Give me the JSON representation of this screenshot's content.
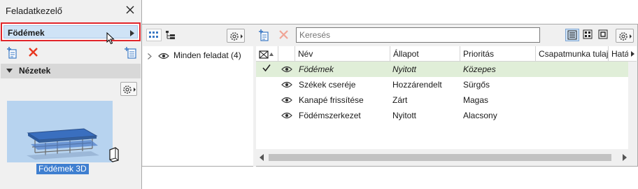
{
  "left_panel": {
    "title": "Feladatkezelő",
    "project": "Födémek",
    "views_section": "Nézetek",
    "thumbnail_label": "Födémek 3D"
  },
  "tree": {
    "root_label": "Minden feladat (4)"
  },
  "search": {
    "placeholder": "Keresés"
  },
  "table": {
    "columns": [
      "Név",
      "Állapot",
      "Prioritás",
      "Csapatmunka tulaj",
      "Határ"
    ],
    "rows": [
      {
        "name": "Födémek",
        "status": "Nyitott",
        "priority": "Közepes",
        "selected": true
      },
      {
        "name": "Székek cseréje",
        "status": "Hozzárendelt",
        "priority": "Sürgős",
        "selected": false
      },
      {
        "name": "Kanapé frissítése",
        "status": "Zárt",
        "priority": "Magas",
        "selected": false
      },
      {
        "name": "Födémszerkezet",
        "status": "Nyitott",
        "priority": "Alacsony",
        "selected": false
      }
    ]
  },
  "colors": {
    "selection_highlight": "#cfe3f6",
    "focus_outline": "#e2262b",
    "selected_row": "#e0eed8",
    "delete_red": "#e8361f",
    "add_blue": "#3a78c4"
  },
  "icons": [
    "close-icon",
    "chevron-right-icon",
    "new-task-icon",
    "delete-icon",
    "task-list-icon",
    "collapse-caret-icon",
    "gear-icon",
    "eye-icon",
    "checkmark-icon",
    "3d-view-icon",
    "grid-view-icon",
    "tree-view-icon",
    "list-view-icon",
    "tiles-view-icon",
    "single-view-icon",
    "sort-icon"
  ]
}
